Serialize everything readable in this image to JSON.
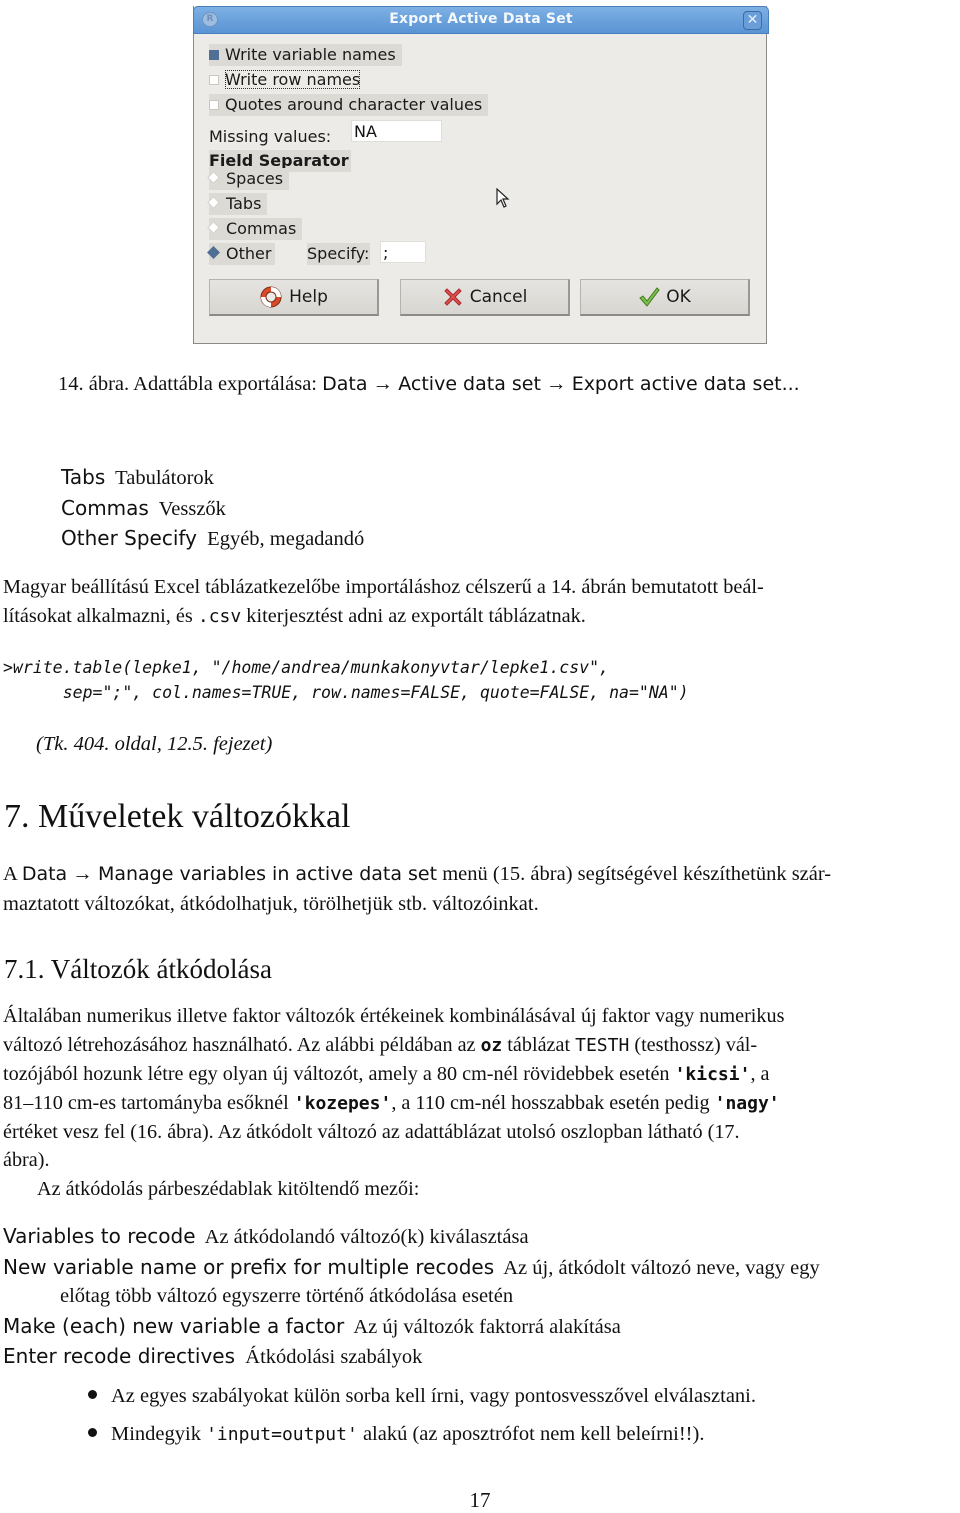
{
  "dialog": {
    "title": "Export Active Data Set",
    "app_icon": "R",
    "close_glyph": "✕",
    "checkboxes": [
      {
        "label": "Write variable names",
        "checked": true
      },
      {
        "label": "Write row names",
        "checked": false
      },
      {
        "label": "Quotes around character values",
        "checked": false
      }
    ],
    "missing_values_label": "Missing values:",
    "missing_values_value": "NA",
    "field_separator_label": "Field Separator",
    "radios": [
      {
        "label": "Spaces",
        "selected": false
      },
      {
        "label": "Tabs",
        "selected": false
      },
      {
        "label": "Commas",
        "selected": false
      },
      {
        "label": "Other",
        "selected": true
      }
    ],
    "specify_label": "Specify:",
    "specify_value": ";",
    "buttons": {
      "help": "Help",
      "cancel": "Cancel",
      "ok": "OK"
    }
  },
  "figure14": {
    "prefix": "14. ábra. Adattábla exportálása: ",
    "path": [
      "Data",
      "Active data set",
      "Export active data set..."
    ],
    "arrow": "→"
  },
  "definitions1": [
    {
      "term": "Tabs",
      "desc": "Tabulátorok"
    },
    {
      "term": "Commas",
      "desc": "Vesszők"
    },
    {
      "term": "Other Specify",
      "desc": "Egyéb, megadandó"
    }
  ],
  "para1": {
    "line1": "Magyar beállítású Excel táblázatkezelőbe importáláshoz célszerű a 14. ábrán bemutatott beál-",
    "line2_a": "lításokat alkalmazni, és ",
    "line2_code": ".csv",
    "line2_b": " kiterjesztést adni az exportált táblázatnak."
  },
  "code": {
    "line1": ">write.table(lepke1, \"/home/andrea/munkakonyvtar/lepke1.csv\",",
    "line2": "    sep=\";\", col.names=TRUE, row.names=FALSE, quote=FALSE, na=\"NA\")"
  },
  "reference": "(Tk. 404. oldal, 12.5. fejezet)",
  "section7": {
    "heading": "7.  Műveletek változókkal",
    "line1_a": "A ",
    "line1_menu1": "Data",
    "line1_arrow": " → ",
    "line1_menu2": "Manage variables in active data set",
    "line1_b": " menü (15. ábra) segítségével készíthetünk szár-",
    "line2": "maztatott változókat, átkódolhatjuk, törölhetjük stb. változóinkat."
  },
  "section71": {
    "heading": "7.1.  Változók átkódolása",
    "l1": "Általában numerikus illetve faktor változók értékeinek kombinálásával új faktor vagy numerikus",
    "l2_a": "változó létrehozásához használható. Az alábbi példában az ",
    "l2_code1": "oz",
    "l2_b": " táblázat ",
    "l2_code2": "TESTH",
    "l2_c": " (testhossz) vál-",
    "l3_a": "tozójából hozunk létre egy olyan új változót, amely a 80 cm-nél rövidebbek esetén ",
    "l3_code": "'kicsi'",
    "l3_b": ", a",
    "l4_a": "81–110 cm-es tartományba esőknél ",
    "l4_code": "'kozepes'",
    "l4_b": ", a 110 cm-nél hosszabbak esetén pedig  ",
    "l4_code2": "'nagy'",
    "l5": "értéket vesz fel (16. ábra). Az átkódolt változó az adattáblázat utolsó oszlopban látható (17.",
    "l6": "ábra).",
    "l7": "Az átkódolás párbeszédablak kitöltendő mezői:"
  },
  "definitions2": [
    {
      "term": "Variables to recode",
      "desc": "Az átkódolandó változó(k) kiválasztása"
    },
    {
      "term": "New variable name or prefix for multiple recodes",
      "desc": "Az új, átkódolt változó neve, vagy egy",
      "cont": "előtag több változó egyszerre történő átkódolása esetén"
    },
    {
      "term": "Make (each) new variable a factor",
      "desc": "Az új változók faktorrá alakítása"
    },
    {
      "term": "Enter recode directives",
      "desc": "Átkódolási szabályok"
    }
  ],
  "bullets": {
    "b1": "Az egyes szabályokat külön sorba kell írni, vagy pontosvesszővel elválasztani.",
    "b2_a": "Mindegyik ",
    "b2_code": "'input=output'",
    "b2_b": " alakú (az aposztrófot nem kell beleírni!!)."
  },
  "page_number": "17",
  "colors": {
    "titlebar": "#5a94d4",
    "dialog_bg": "#edebe7",
    "checked": "#4f6f94"
  }
}
